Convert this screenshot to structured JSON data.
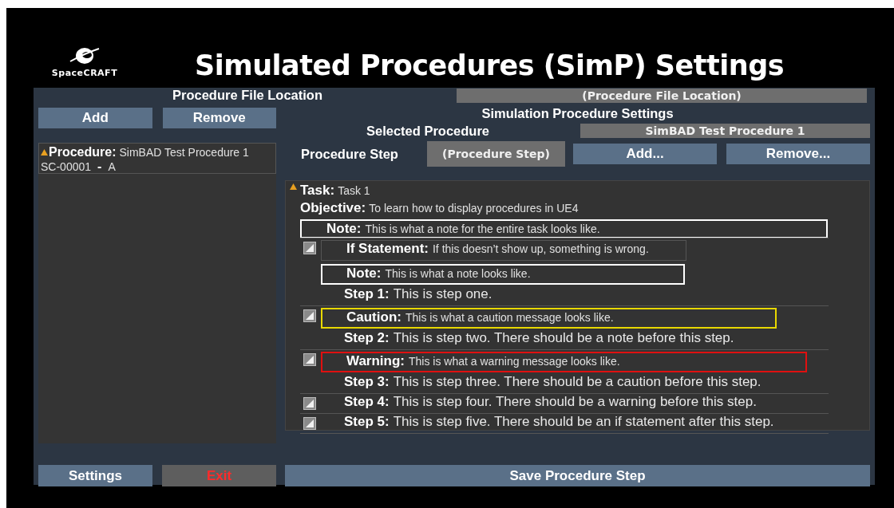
{
  "logo": {
    "text": "SpaceCRAFT"
  },
  "title": "Simulated Procedures (SimP) Settings",
  "file_location": {
    "label": "Procedure File Location",
    "value": "(Procedure File Location)"
  },
  "left_buttons": [
    {
      "label": "Add",
      "disabled": false
    },
    {
      "label": "Remove",
      "disabled": false
    }
  ],
  "procedures": [
    {
      "label": "Procedure:",
      "name": "SimBAD Test Procedure 1",
      "id": "SC-00001",
      "separator": "-",
      "revision": "A"
    }
  ],
  "settings_title": "Simulation Procedure Settings",
  "selected_procedure": {
    "label": "Selected Procedure",
    "value": "SimBAD Test Procedure 1"
  },
  "procedure_step": {
    "label": "Procedure Step",
    "value": "(Procedure Step)",
    "buttons": [
      {
        "label": "Add...",
        "disabled": false
      },
      {
        "label": "Remove...",
        "disabled": false
      }
    ]
  },
  "task": {
    "label": "Task:",
    "value": "Task 1",
    "objective_label": "Objective:",
    "objective": "To learn how to display procedures in UE4",
    "note": {
      "label": "Note:",
      "text": "This is what a note for the entire task looks like."
    },
    "groups": [
      {
        "messages": [
          {
            "kind": "if",
            "label": "If Statement:",
            "text": "If this doesn’t show up, something is wrong."
          },
          {
            "kind": "note",
            "label": "Note:",
            "text": "This is what a note looks like."
          }
        ],
        "step_label": "Step 1:",
        "step_text": "This is step one."
      },
      {
        "messages": [
          {
            "kind": "caution",
            "label": "Caution:",
            "text": "This is what a caution message looks like."
          }
        ],
        "step_label": "Step 2:",
        "step_text": "This is step two. There should be a note before this step."
      },
      {
        "messages": [
          {
            "kind": "warning",
            "label": "Warning:",
            "text": "This is what a warning message looks like."
          }
        ],
        "step_label": "Step 3:",
        "step_text": "This is step three. There should be a caution before this step."
      },
      {
        "step_label": "Step 4:",
        "step_text": "This is step four. There should be a warning before this step."
      },
      {
        "step_label": "Step 5:",
        "step_text": "This is step five. There should be an if statement after this step."
      }
    ]
  },
  "footer": [
    {
      "label": "Settings",
      "disabled": false
    },
    {
      "label": "Exit",
      "disabled": true
    },
    {
      "label": "Save Procedure Step",
      "disabled": false
    }
  ]
}
